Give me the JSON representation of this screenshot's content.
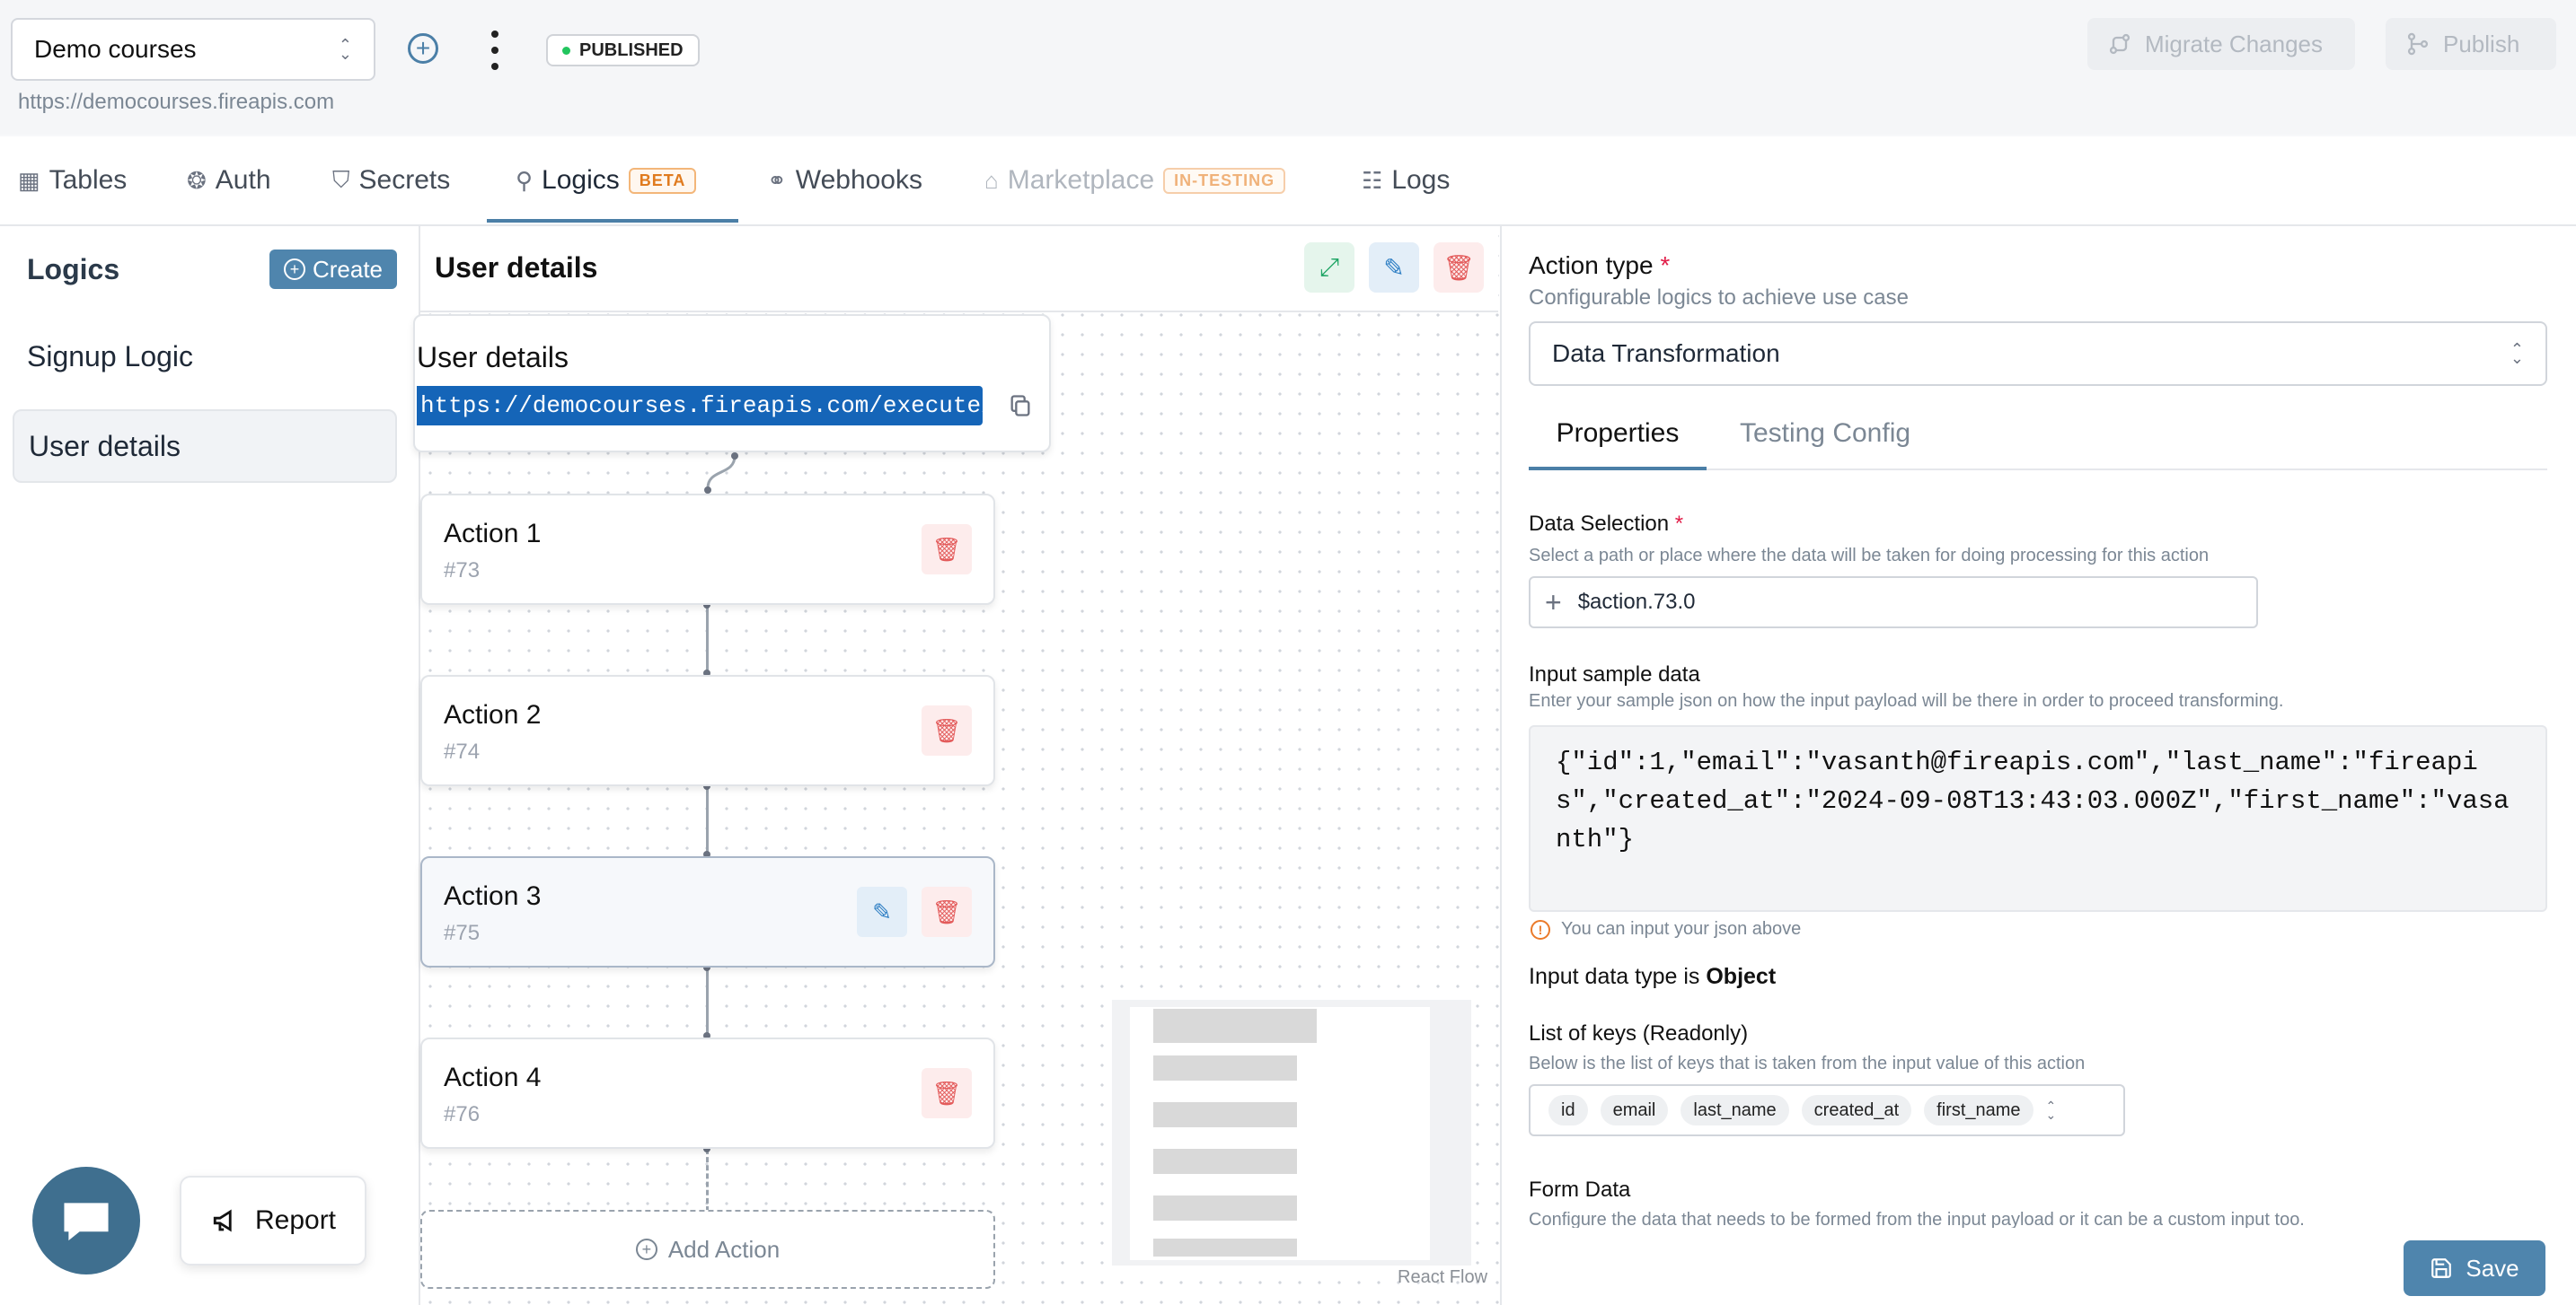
{
  "header": {
    "project": "Demo courses",
    "status_badge": "PUBLISHED",
    "url": "https://democourses.fireapis.com",
    "migrate_label": "Migrate Changes",
    "publish_label": "Publish"
  },
  "tabs": [
    {
      "label": "Tables",
      "icon": "table-icon"
    },
    {
      "label": "Auth",
      "icon": "brain-icon"
    },
    {
      "label": "Secrets",
      "icon": "shield-icon"
    },
    {
      "label": "Logics",
      "icon": "logic-icon",
      "badge": "BETA"
    },
    {
      "label": "Webhooks",
      "icon": "webhook-icon"
    },
    {
      "label": "Marketplace",
      "icon": "store-icon",
      "badge": "IN-TESTING"
    },
    {
      "label": "Logs",
      "icon": "list-icon"
    }
  ],
  "sidebar": {
    "title": "Logics",
    "create_label": "Create",
    "items": [
      "Signup Logic",
      "User details"
    ]
  },
  "canvas": {
    "title": "User details",
    "trigger_title": "User details",
    "endpoint": "https://democourses.fireapis.com/execute/…",
    "actions": [
      {
        "title": "Action 1",
        "id": "#73"
      },
      {
        "title": "Action 2",
        "id": "#74"
      },
      {
        "title": "Action 3",
        "id": "#75"
      },
      {
        "title": "Action 4",
        "id": "#76"
      }
    ],
    "add_action_label": "Add Action",
    "react_flow_label": "React Flow"
  },
  "panel": {
    "action_type_label": "Action type",
    "action_type_hint": "Configurable logics to achieve use case",
    "action_type_value": "Data Transformation",
    "tabs": [
      "Properties",
      "Testing Config"
    ],
    "data_selection_label": "Data Selection",
    "data_selection_hint": "Select a path or place where the data will be taken for doing processing for this action",
    "data_selection_value": "$action.73.0",
    "input_sample_label": "Input sample data",
    "input_sample_hint": "Enter your sample json on how the input payload will be there in order to proceed transforming.",
    "input_sample_value": "{\"id\":1,\"email\":\"vasanth@fireapis.com\",\"last_name\":\"fireapis\",\"created_at\":\"2024-09-08T13:43:03.000Z\",\"first_name\":\"vasanth\"}",
    "json_info": "You can input your json above",
    "input_type_prefix": "Input data type is",
    "input_type_value": "Object",
    "keys_label": "List of keys (Readonly)",
    "keys_hint": "Below is the list of keys that is taken from the input value of this action",
    "keys": [
      "id",
      "email",
      "last_name",
      "created_at",
      "first_name"
    ],
    "form_data_label": "Form Data",
    "form_data_hint": "Configure the data that needs to be formed from the input payload or it can be a custom input too.",
    "save_label": "Save"
  },
  "floating": {
    "report_label": "Report"
  },
  "colors": {
    "accent": "#4f85ad",
    "endpoint_bg": "#1565b8",
    "delete": "#e35b5b",
    "published_dot": "#22c55e"
  }
}
